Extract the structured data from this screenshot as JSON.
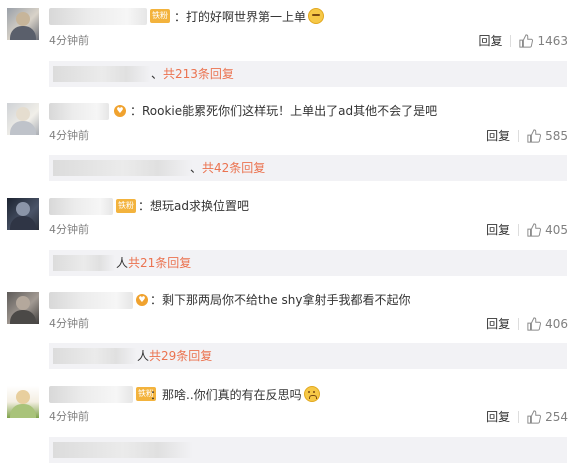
{
  "comments": [
    {
      "badge": "铁粉",
      "text": "：打的好啊世界第一上单",
      "emoji": "embarrassed-emoji",
      "time": "4分钟前",
      "reply": "回复",
      "likes": "1463",
      "sub_prefix": "、",
      "sub_count": "共213条回复"
    },
    {
      "text": "：Rookie能累死你们这样玩！上单出了ad其他不会了是吧",
      "time": "4分钟前",
      "reply": "回复",
      "likes": "585",
      "sub_prefix": "、",
      "sub_count": "共42条回复"
    },
    {
      "badge": "铁粉",
      "text": "：想玩ad求换位置吧",
      "time": "4分钟前",
      "reply": "回复",
      "likes": "405",
      "sub_prefix": "人",
      "sub_count": "共21条回复"
    },
    {
      "text": "：剩下那两局你不给the shy拿射手我都看不起你",
      "time": "4分钟前",
      "reply": "回复",
      "likes": "406",
      "sub_prefix": "人",
      "sub_count": "共29条回复"
    },
    {
      "badge": "铁粉",
      "text": "：那啥..你们真的有在反思吗",
      "emoji": "sad-emoji",
      "time": "4分钟前",
      "reply": "回复",
      "likes": "254",
      "sub_prefix": "",
      "sub_count": ""
    }
  ]
}
